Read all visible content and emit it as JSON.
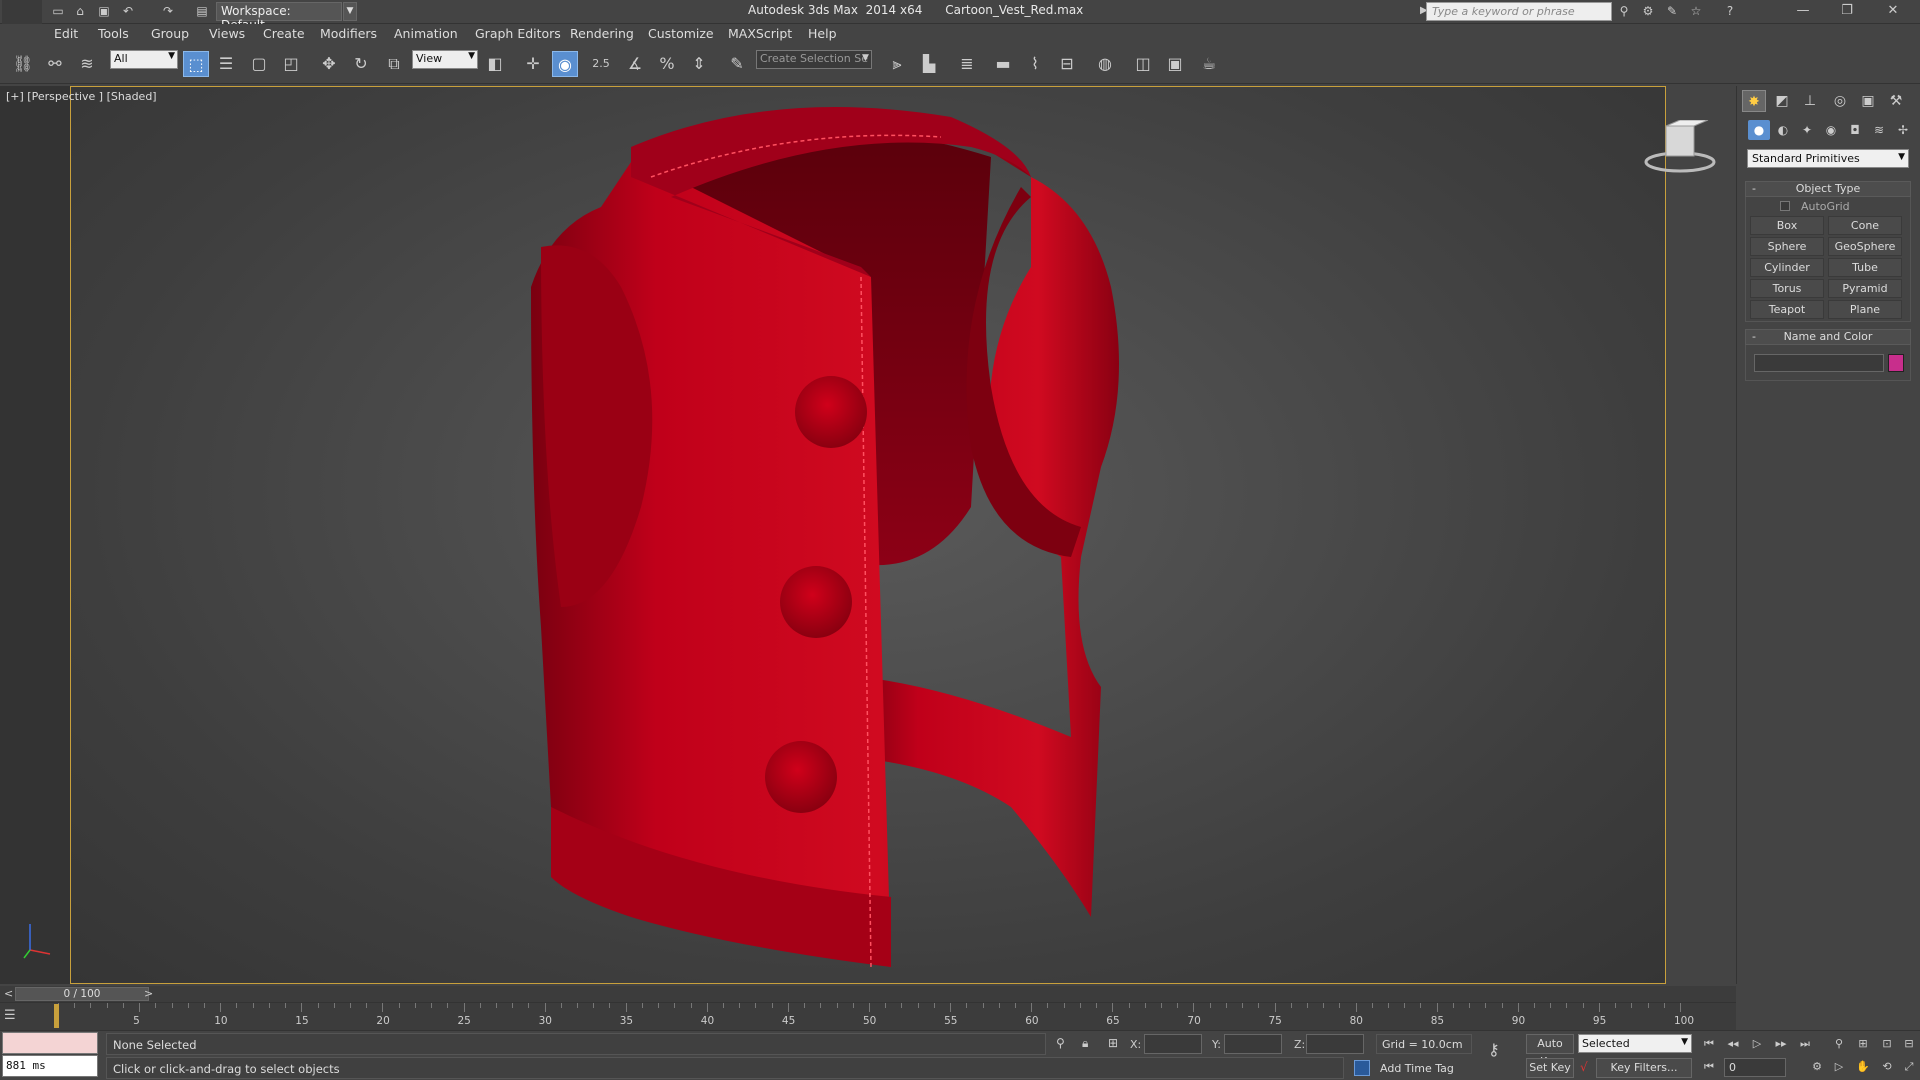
{
  "titlebar": {
    "workspace": "Workspace: Default",
    "app_title": "Autodesk 3ds Max  2014 x64      Cartoon_Vest_Red.max",
    "search_placeholder": "Type a keyword or phrase"
  },
  "menu": [
    "Edit",
    "Tools",
    "Group",
    "Views",
    "Create",
    "Modifiers",
    "Animation",
    "Graph Editors",
    "Rendering",
    "Customize",
    "MAXScript",
    "Help"
  ],
  "toolbar": {
    "filter": "All",
    "ref_coord": "View",
    "snap_label": "2.5",
    "selection_set_placeholder": "Create Selection Se"
  },
  "viewport": {
    "label": "[+] [Perspective ] [Shaded]",
    "object_color": "#c0001a"
  },
  "command_panel": {
    "category": "Standard Primitives",
    "object_type_title": "Object Type",
    "autogrid": "AutoGrid",
    "primitives": [
      "Box",
      "Cone",
      "Sphere",
      "GeoSphere",
      "Cylinder",
      "Tube",
      "Torus",
      "Pyramid",
      "Teapot",
      "Plane"
    ],
    "name_color_title": "Name and Color",
    "swatch_color": "#c82e8c"
  },
  "timeline": {
    "slider_label": "0 / 100",
    "prev": "<",
    "next": ">",
    "ticks": [
      "5",
      "10",
      "15",
      "20",
      "25",
      "30",
      "35",
      "40",
      "45",
      "50",
      "55",
      "60",
      "65",
      "70",
      "75",
      "80",
      "85",
      "90",
      "95",
      "100"
    ]
  },
  "status": {
    "ms_time": "881 ms",
    "selection": "None Selected",
    "prompt": "Click or click-and-drag to select objects",
    "x_label": "X:",
    "y_label": "Y:",
    "z_label": "Z:",
    "grid": "Grid = 10.0cm",
    "add_time_tag": "Add Time Tag",
    "auto_key": "Auto Key",
    "set_key": "Set Key",
    "key_mode": "Selected",
    "key_filters": "Key Filters...",
    "frame": "0"
  }
}
